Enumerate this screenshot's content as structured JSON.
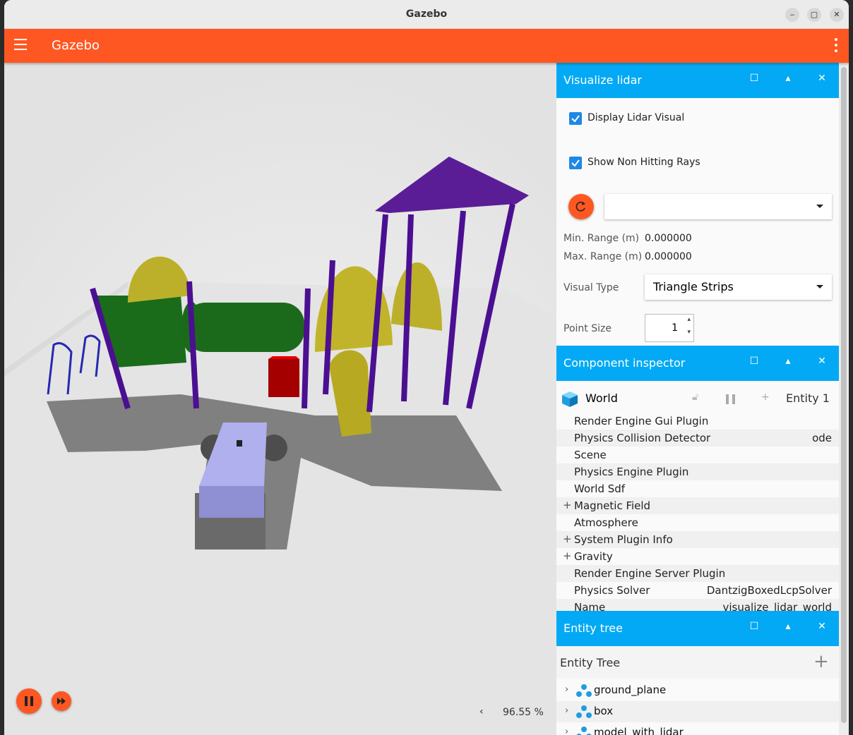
{
  "window": {
    "title": "Gazebo",
    "minimize": "‒",
    "maximize": "▢",
    "close": "✕"
  },
  "appbar": {
    "title": "Gazebo"
  },
  "scene": {
    "zoom": "96.55 %"
  },
  "lidar_panel": {
    "title": "Visualize lidar",
    "display_lidar_label": "Display Lidar Visual",
    "show_non_hitting_label": "Show Non Hitting Rays",
    "topic_value": "",
    "min_range_label": "Min. Range (m)",
    "min_range_value": "0.000000",
    "max_range_label": "Max. Range (m)",
    "max_range_value": "0.000000",
    "visual_type_label": "Visual Type",
    "visual_type_value": "Triangle Strips",
    "point_size_label": "Point Size",
    "point_size_value": "1"
  },
  "inspector": {
    "title": "Component inspector",
    "entity_type": "World",
    "entity_id": "Entity 1",
    "rows": [
      {
        "key": "Render Engine Gui Plugin",
        "value": "",
        "expandable": false
      },
      {
        "key": "Physics Collision Detector",
        "value": "ode",
        "expandable": false
      },
      {
        "key": "Scene",
        "value": "",
        "expandable": false
      },
      {
        "key": "Physics Engine Plugin",
        "value": "",
        "expandable": false
      },
      {
        "key": "World Sdf",
        "value": "",
        "expandable": false
      },
      {
        "key": "Magnetic Field",
        "value": "",
        "expandable": true
      },
      {
        "key": "Atmosphere",
        "value": "",
        "expandable": false
      },
      {
        "key": "System Plugin Info",
        "value": "",
        "expandable": true
      },
      {
        "key": "Gravity",
        "value": "",
        "expandable": true
      },
      {
        "key": "Render Engine Server Plugin",
        "value": "",
        "expandable": false
      },
      {
        "key": "Physics Solver",
        "value": "DantzigBoxedLcpSolver",
        "expandable": false
      },
      {
        "key": "Name",
        "value": "visualize_lidar_world",
        "expandable": false
      }
    ]
  },
  "entity_tree": {
    "title": "Entity tree",
    "header": "Entity Tree",
    "items": [
      "ground_plane",
      "box",
      "model_with_lidar"
    ]
  },
  "colors": {
    "accent": "#ff5722",
    "panel_header": "#03a9f4",
    "checkbox": "#1e88e5"
  }
}
